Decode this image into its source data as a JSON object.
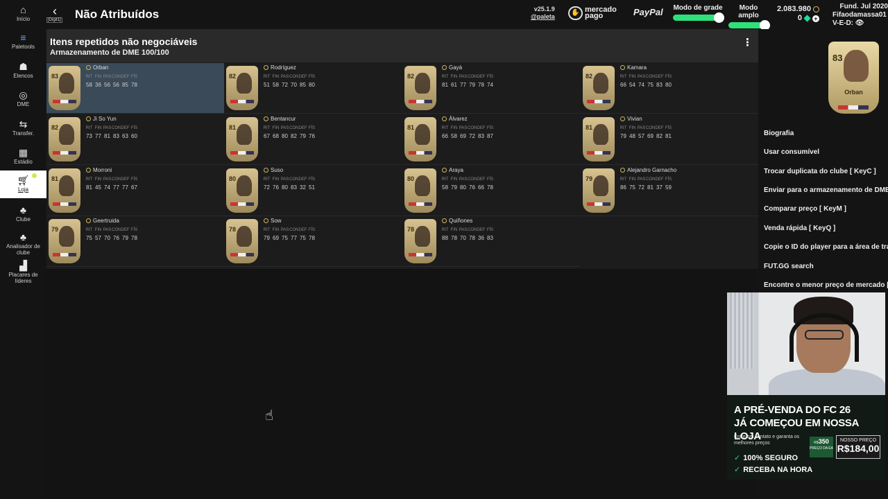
{
  "nav": {
    "items": [
      {
        "label": "Início",
        "icon": "home-icon"
      },
      {
        "label": "Paletools",
        "icon": "paletools-icon"
      },
      {
        "label": "Elencos",
        "icon": "squad-icon"
      },
      {
        "label": "DME",
        "icon": "sbc-icon"
      },
      {
        "label": "Transfer.",
        "icon": "transfer-icon"
      },
      {
        "label": "Estádio",
        "icon": "stadium-icon"
      },
      {
        "label": "Loja",
        "icon": "store-icon"
      },
      {
        "label": "Clube",
        "icon": "club-icon"
      },
      {
        "label": "Analisador de clube",
        "icon": "club-analyzer-icon"
      },
      {
        "label": "Placares de líderes",
        "icon": "leaderboard-icon"
      }
    ]
  },
  "header": {
    "title": "Não Atribuídos",
    "back_hint": "[Digit1]",
    "version": "v25.1.9",
    "handle": "@paleta",
    "sponsor_mp": "mercado pago",
    "sponsor_pp": "PayPal",
    "grid_mode_label": "Modo de grade",
    "wide_mode_label": "Modo amplo",
    "coins": "2.083.980",
    "points": "0",
    "club_founded": "Fund. Jul 2020",
    "club_name": "Fifaodamassa01",
    "record": "V-E-D:"
  },
  "panel": {
    "title": "Itens repetidos não negociáveis",
    "subtitle": "Armazenamento de DME 100/100"
  },
  "stat_labels": [
    "RIT",
    "FIN",
    "PAS",
    "CON",
    "DEF",
    "FÍS"
  ],
  "players": [
    {
      "name": "Orban",
      "rating": "83",
      "stats": [
        "58",
        "36",
        "56",
        "56",
        "85",
        "78"
      ],
      "selected": true
    },
    {
      "name": "Rodríguez",
      "rating": "82",
      "stats": [
        "51",
        "58",
        "72",
        "70",
        "85",
        "80"
      ]
    },
    {
      "name": "Gayà",
      "rating": "82",
      "stats": [
        "81",
        "61",
        "77",
        "79",
        "78",
        "74"
      ]
    },
    {
      "name": "Kamara",
      "rating": "82",
      "stats": [
        "66",
        "54",
        "74",
        "75",
        "83",
        "80"
      ]
    },
    {
      "name": "Ji So Yun",
      "rating": "82",
      "stats": [
        "73",
        "77",
        "81",
        "83",
        "63",
        "60"
      ]
    },
    {
      "name": "Bentancur",
      "rating": "81",
      "stats": [
        "67",
        "68",
        "80",
        "82",
        "79",
        "76"
      ]
    },
    {
      "name": "Álvarez",
      "rating": "81",
      "stats": [
        "66",
        "58",
        "69",
        "72",
        "83",
        "87"
      ]
    },
    {
      "name": "Vivian",
      "rating": "81",
      "stats": [
        "79",
        "48",
        "57",
        "69",
        "82",
        "81"
      ]
    },
    {
      "name": "Morroni",
      "rating": "81",
      "stats": [
        "81",
        "45",
        "74",
        "77",
        "77",
        "67"
      ]
    },
    {
      "name": "Suso",
      "rating": "80",
      "stats": [
        "72",
        "76",
        "80",
        "83",
        "32",
        "51"
      ]
    },
    {
      "name": "Araya",
      "rating": "80",
      "stats": [
        "58",
        "79",
        "80",
        "76",
        "66",
        "78"
      ]
    },
    {
      "name": "Alejandro Garnacho",
      "rating": "79",
      "stats": [
        "86",
        "75",
        "72",
        "81",
        "37",
        "59"
      ]
    },
    {
      "name": "Geertruida",
      "rating": "79",
      "stats": [
        "75",
        "57",
        "70",
        "76",
        "79",
        "78"
      ]
    },
    {
      "name": "Sow",
      "rating": "78",
      "stats": [
        "79",
        "69",
        "75",
        "77",
        "75",
        "78"
      ]
    },
    {
      "name": "Quiñones",
      "rating": "78",
      "stats": [
        "88",
        "78",
        "70",
        "78",
        "36",
        "83"
      ]
    }
  ],
  "side": {
    "card_name": "Orban",
    "card_rating": "83",
    "menu": [
      "Biografia",
      "Usar consumível",
      "Trocar duplicata do clube [ KeyC ]",
      "Enviar para o armazenamento de DME",
      "Comparar preço [ KeyM ]",
      "Venda rápida [ KeyQ ]",
      "Copie o ID do player para a área de trans",
      "FUT.GG search",
      "Encontre o menor preço de mercado [ Ke"
    ]
  },
  "ad": {
    "headline1": "A PRÉ-VENDA DO FC 26",
    "headline2": "JÁ COMEÇOU EM NOSSA LOJA",
    "small": "Entre em contato e garanta os melhores preços",
    "old_price_label_top": "R$",
    "old_price": "350",
    "old_price_label": "PREÇO DA EA",
    "our_price_label": "NOSSO PREÇO",
    "our_price": "R$184,00",
    "check1": "100% SEGURO",
    "check2": "RECEBA NA HORA"
  }
}
